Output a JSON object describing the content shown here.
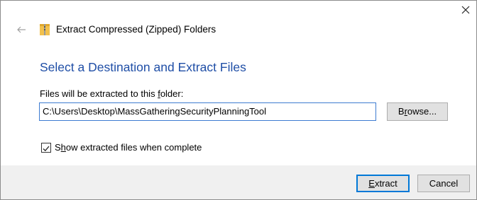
{
  "window": {
    "title": "Extract Compressed (Zipped) Folders",
    "close_icon": "close-icon",
    "back_icon": "back-arrow-icon"
  },
  "main": {
    "heading": "Select a Destination and Extract Files",
    "folder_label_pre": "Files will be extracted to this ",
    "folder_label_accel": "f",
    "folder_label_post": "older:",
    "path_value": "C:\\Users\\Desktop\\MassGatheringSecurityPlanningTool",
    "browse_accel": "r",
    "browse_pre": "B",
    "browse_post": "owse...",
    "show_files": {
      "checked": true,
      "accel": "h",
      "pre": "S",
      "post": "ow extracted files when complete"
    }
  },
  "footer": {
    "extract_accel": "E",
    "extract_post": "xtract",
    "cancel_label": "Cancel"
  },
  "colors": {
    "heading": "#1f4ea6",
    "focus_border": "#0078d7",
    "footer_bg": "#f0f0f0"
  }
}
